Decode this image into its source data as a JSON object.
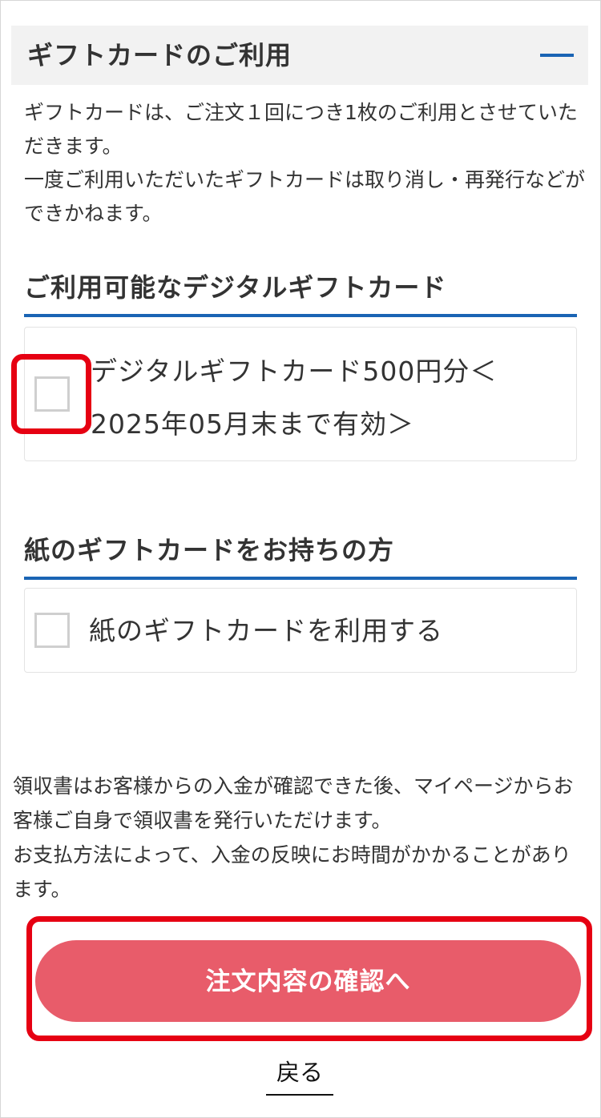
{
  "gift_section": {
    "title": "ギフトカードのご利用",
    "intro_lines": [
      "ギフトカードは、ご注文１回につき1枚のご利用とさせていただきます。",
      "一度ご利用いただいたギフトカードは取り消し・再発行などができかねます。"
    ]
  },
  "digital_cards": {
    "title": "ご利用可能なデジタルギフトカード",
    "items": [
      {
        "label_line1": "デジタルギフトカード500円分＜",
        "label_line2": "2025年05月末まで有効＞",
        "checked": false
      }
    ]
  },
  "paper_cards": {
    "title": "紙のギフトカードをお持ちの方",
    "option_label": "紙のギフトカードを利用する",
    "checked": false
  },
  "receipt_notice": {
    "lines": [
      "領収書はお客様からの入金が確認できた後、マイページからお客様ご自身で領収書を発行いただけます。",
      "お支払方法によって、入金の反映にお時間がかかることがあります。"
    ]
  },
  "actions": {
    "confirm_label": "注文内容の確認へ",
    "back_label": "戻る"
  },
  "colors": {
    "accent_blue": "#1a64b4",
    "button_pink": "#e85c6a",
    "highlight_red": "#e60012"
  }
}
